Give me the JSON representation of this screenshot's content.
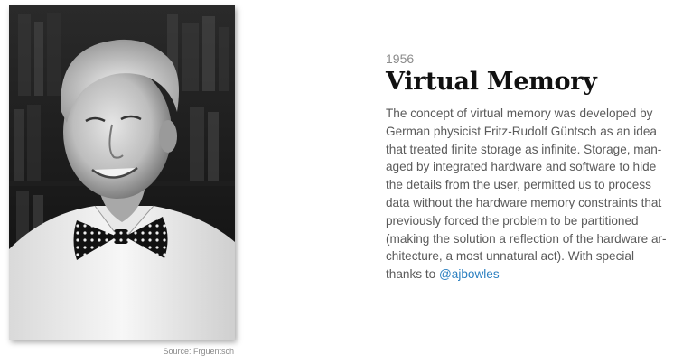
{
  "entry": {
    "year": "1956",
    "title": "Virtual Memory",
    "lines": [
      "The concept of virtual memory was developed by",
      "German physicist Fritz-Rudolf Güntsch as an idea",
      "that treated finite storage as infinite. Storage, man-",
      "aged by integrated hardware and software to hide",
      "the details from the user, permitted us to process",
      "data without the hardware memory constraints that",
      "previously forced the problem to be partitioned",
      "(making the solution a reflection of the hardware ar-",
      "chitecture, a most unnatural act). With special"
    ],
    "last_line_prefix": "thanks to ",
    "thanks_link": "@ajbowles"
  },
  "photo": {
    "caption": "Source: Frguentsch"
  },
  "colors": {
    "link": "#2a7fc0",
    "title": "#111111",
    "body": "#5a5a5a",
    "meta": "#8c8c8c"
  }
}
